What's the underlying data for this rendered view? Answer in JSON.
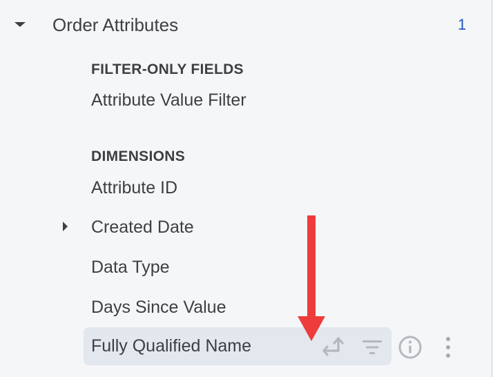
{
  "section": {
    "title": "Order Attributes",
    "count": "1"
  },
  "groups": {
    "filter_only_label": "FILTER-ONLY FIELDS",
    "dimensions_label": "DIMENSIONS"
  },
  "fields": {
    "attribute_value_filter": "Attribute Value Filter",
    "attribute_id": "Attribute ID",
    "created_date": "Created Date",
    "data_type": "Data Type",
    "days_since_value": "Days Since Value",
    "fully_qualified_name": "Fully Qualified Name"
  },
  "icons": {
    "expand": "caret-down-icon",
    "collapsed": "caret-right-icon",
    "pivot": "pivot-icon",
    "filter": "filter-icon",
    "info": "info-icon",
    "more": "more-vertical-icon",
    "annotation": "red-arrow-icon"
  },
  "colors": {
    "background": "#f5f6f8",
    "text": "#3c4043",
    "count": "#1a56c4",
    "row_highlight": "#e3e7ee",
    "icon_muted": "#b4b8be",
    "annotation": "#ee3b3b"
  }
}
